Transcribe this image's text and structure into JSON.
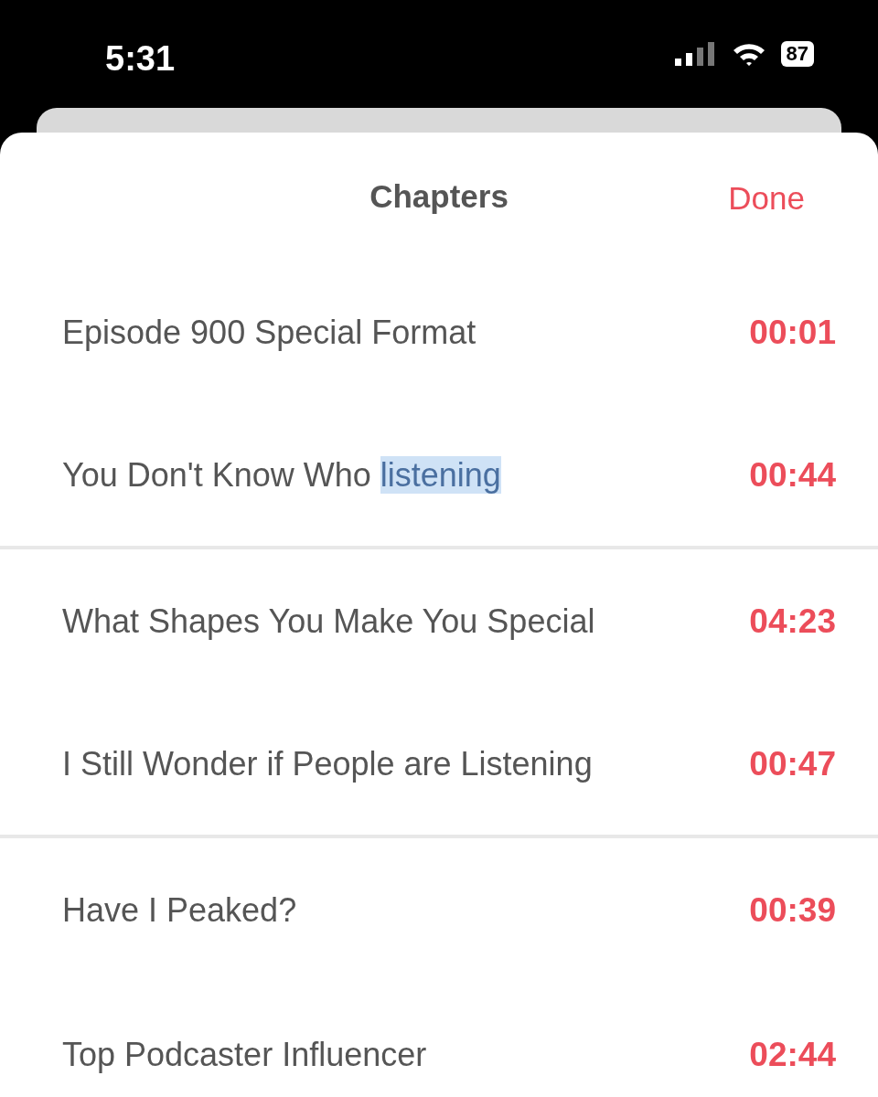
{
  "status_bar": {
    "time": "5:31",
    "battery": "87"
  },
  "sheet": {
    "title": "Chapters",
    "done": "Done"
  },
  "chapters": [
    {
      "title": "Episode 900 Special Format",
      "time": "00:01",
      "divider_after": false
    },
    {
      "title": "You Don't Know Who",
      "selection": "listening",
      "time": "00:44",
      "divider_after": true
    },
    {
      "title": "What Shapes You Make You Special",
      "time": "04:23",
      "divider_after": false
    },
    {
      "title": "I Still Wonder if People are Listening",
      "time": "00:47",
      "divider_after": true
    },
    {
      "title": "Have I Peaked?",
      "time": "00:39",
      "divider_after": false
    },
    {
      "title": "Top Podcaster Influencer",
      "time": "02:44",
      "divider_after": false
    }
  ]
}
